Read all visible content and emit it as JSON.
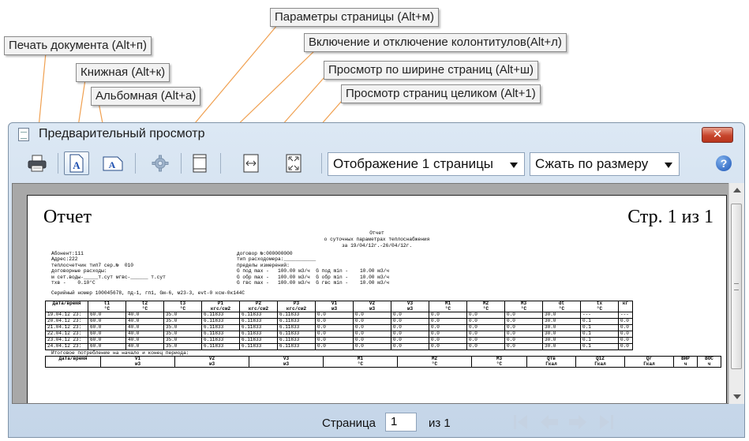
{
  "callouts": {
    "print": "Печать документа (Alt+п)",
    "portrait": "Книжная (Alt+к)",
    "landscape": "Альбомная (Alt+а)",
    "page_setup": "Параметры страницы (Alt+м)",
    "headers_footers": "Включение и отключение колонтитулов(Alt+л)",
    "page_width": "Просмотр по ширине страниц (Alt+ш)",
    "whole_page": "Просмотр  страниц целиком (Alt+1)"
  },
  "window": {
    "title": "Предварительный просмотр",
    "close_label": "✕",
    "help_label": "?"
  },
  "toolbar": {
    "view_mode": "Отображение 1 страницы",
    "fit_mode": "Сжать по размеру"
  },
  "icons": {
    "print": "printer-icon",
    "portrait": "portrait-page-icon",
    "landscape": "landscape-page-icon",
    "settings": "gear-icon",
    "header_footer": "header-footer-icon",
    "page_width": "fit-width-icon",
    "whole_page": "fit-page-icon"
  },
  "report": {
    "heading_left": "Отчет",
    "heading_right": "Стр. 1 из 1",
    "title_line1": "Отчет",
    "title_line2": "о суточных параметрах теплоснабжения",
    "title_line3": "за 19/04/12г.-26/04/12г.",
    "info_left": [
      "Абонент:111",
      "Адрес:222",
      "теплосчетчик тип7 сер.№  010",
      "договорные расходы:",
      "м сет.воды-_____т.сут мгвс-______ т.сут",
      "тхв -    0.10°C"
    ],
    "info_right": [
      "договор №:000000000",
      "тип расходомера:___________",
      "пределы измерений:",
      "G под max -   100.00 м3/ч  G под min -    10.00 м3/ч",
      "G обр max -   100.00 м3/ч  G обр min -    10.00 м3/ч",
      "G гвс max -   100.00 м3/ч  G гвс min -    10.00 м3/ч"
    ],
    "serial_line": "Серийный номер 100045678, пд-1, гп1, Gм-6, м23-3, evt-0 ксм-0к144С",
    "table_headers": [
      [
        "Дата/время",
        ""
      ],
      [
        "t1",
        "°C"
      ],
      [
        "t2",
        "°C"
      ],
      [
        "t3",
        "°C"
      ],
      [
        "P1",
        "кгс/см2"
      ],
      [
        "P2",
        "кгс/см2"
      ],
      [
        "P3",
        "кгс/см2"
      ],
      [
        "V1",
        "м3"
      ],
      [
        "V2",
        "м3"
      ],
      [
        "V3",
        "м3"
      ],
      [
        "M1",
        "°C"
      ],
      [
        "M2",
        "°C"
      ],
      [
        "M3",
        "°C"
      ],
      [
        "dt",
        "°C"
      ],
      [
        "tx",
        "°C"
      ],
      [
        "",
        "кг"
      ]
    ],
    "table_rows": [
      [
        "19.04.12 23:",
        "60.0",
        "40.0",
        "35.0",
        "6.11833",
        "6.11833",
        "6.11833",
        "0.0",
        "0.0",
        "0.0",
        "0.0",
        "0.0",
        "0.0",
        "30.0",
        "---",
        "---"
      ],
      [
        "20.04.12 23:",
        "60.0",
        "40.0",
        "35.0",
        "6.11833",
        "6.11833",
        "6.11833",
        "0.0",
        "0.0",
        "0.0",
        "0.0",
        "0.0",
        "0.0",
        "30.0",
        "0.1",
        "0.0"
      ],
      [
        "21.04.12 23:",
        "60.0",
        "40.0",
        "35.0",
        "6.11833",
        "6.11833",
        "6.11833",
        "0.0",
        "0.0",
        "0.0",
        "0.0",
        "0.0",
        "0.0",
        "30.0",
        "0.1",
        "0.0"
      ],
      [
        "22.04.12 23:",
        "60.0",
        "40.0",
        "35.0",
        "6.11833",
        "6.11833",
        "6.11833",
        "0.0",
        "0.0",
        "0.0",
        "0.0",
        "0.0",
        "0.0",
        "30.0",
        "0.1",
        "0.0"
      ],
      [
        "23.04.12 23:",
        "60.0",
        "40.0",
        "35.0",
        "6.11833",
        "6.11833",
        "6.11833",
        "0.0",
        "0.0",
        "0.0",
        "0.0",
        "0.0",
        "0.0",
        "30.0",
        "0.1",
        "0.0"
      ],
      [
        "24.04.12 23:",
        "60.0",
        "40.0",
        "35.0",
        "6.11833",
        "6.11833",
        "6.11833",
        "0.0",
        "0.0",
        "0.0",
        "0.0",
        "0.0",
        "0.0",
        "30.0",
        "0.1",
        "0.0"
      ]
    ],
    "totals_caption": "Итоговое потребление на начало и конец периода:",
    "totals_headers": [
      [
        "Дата/время",
        ""
      ],
      [
        "V1",
        "м3"
      ],
      [
        "V2",
        "м3"
      ],
      [
        "V3",
        "м3"
      ],
      [
        "M1",
        "°C"
      ],
      [
        "M2",
        "°C"
      ],
      [
        "M3",
        "°C"
      ],
      [
        "Qтв",
        "Гкал"
      ],
      [
        "Q12",
        "Гкал"
      ],
      [
        "Qr",
        "Гкал"
      ],
      [
        "ВНР",
        "ч"
      ],
      [
        "ВОС",
        "ч"
      ]
    ]
  },
  "status": {
    "page_label": "Страница",
    "page_value": "1",
    "page_of": "из 1"
  }
}
